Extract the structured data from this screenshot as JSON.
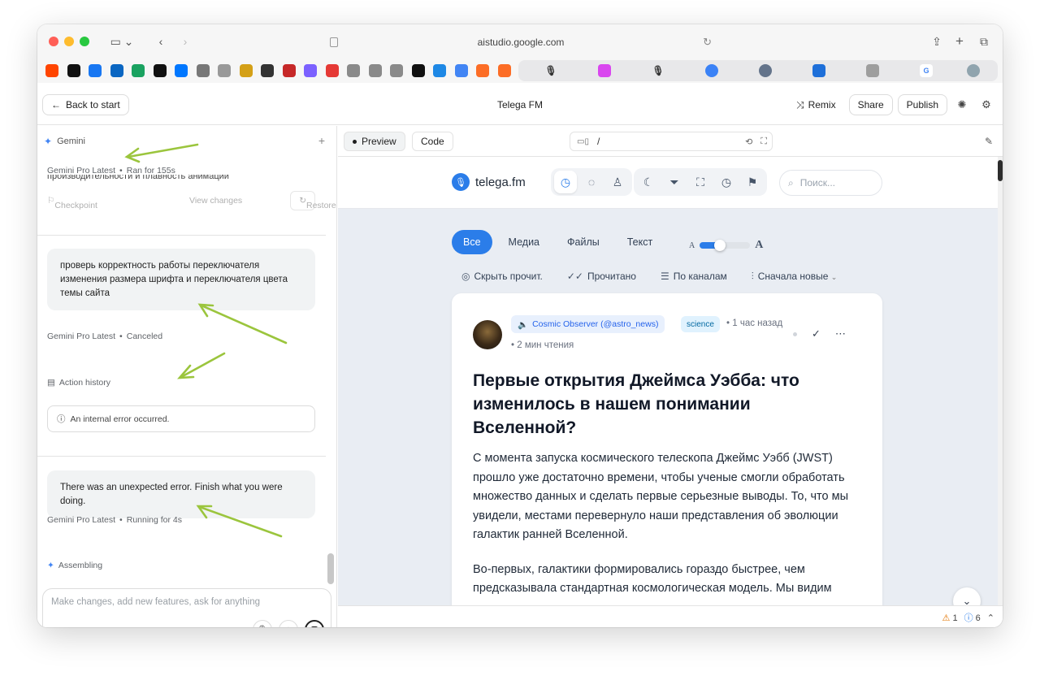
{
  "browser": {
    "url": "aistudio.google.com"
  },
  "header": {
    "back_label": "Back to start",
    "title": "Telega FM",
    "remix_label": "Remix",
    "share_label": "Share",
    "publish_label": "Publish"
  },
  "left_panel": {
    "model_name": "Gemini",
    "run1": {
      "model": "Gemini Pro Latest",
      "status": "Ran for 155s",
      "cut_text": "производительности и плавность анимации"
    },
    "checkpoint_label": "Checkpoint",
    "view_changes_label": "View changes",
    "restore_label": "Restore",
    "user_msg_1": "проверь корректность работы переключателя изменения размера шрифта и переключателя цвета темы сайта",
    "run2": {
      "model": "Gemini Pro Latest",
      "status": "Canceled"
    },
    "action_history_label": "Action history",
    "error_text": "An internal error occurred.",
    "user_msg_2": "There was an unexpected error. Finish what you were doing.",
    "run3": {
      "model": "Gemini Pro Latest",
      "status": "Running for 4s"
    },
    "assembling_label": "Assembling",
    "prompt_placeholder": "Make changes, add new features, ask for anything"
  },
  "right_panel": {
    "tab_preview": "Preview",
    "tab_code": "Code",
    "path": "/"
  },
  "site": {
    "logo_text": "telega.fm",
    "search_placeholder": "Поиск...",
    "filters": [
      "Все",
      "Медиа",
      "Файлы",
      "Текст"
    ],
    "font_small": "A",
    "font_large": "A",
    "font_size_level": 0.4,
    "actions": {
      "hide_read": "Скрыть прочит.",
      "read": "Прочитано",
      "by_channels": "По каналам",
      "newest_first": "Сначала новые"
    },
    "card": {
      "source": "Cosmic Observer (@astro_news)",
      "category": "science",
      "time_ago": "1 час назад",
      "read_time": "2 мин чтения",
      "title": "Первые открытия Джеймса Уэбба: что изменилось в нашем понимании Вселенной?",
      "paragraph_1": "С момента запуска космического телескопа Джеймс Уэбб (JWST) прошло уже достаточно времени, чтобы ученые смогли обработать множество данных и сделать первые серьезные выводы. То, что мы увидели, местами перевернуло наши представления об эволюции галактик ранней Вселенной.",
      "paragraph_2": "Во-первых, галактики формировались гораздо быстрее, чем предсказывала стандартная космологическая модель. Мы видим"
    }
  },
  "status": {
    "warnings": "1",
    "infos": "6"
  },
  "colors": {
    "accent": "#2b7de9",
    "arrow": "#9bc53d"
  }
}
